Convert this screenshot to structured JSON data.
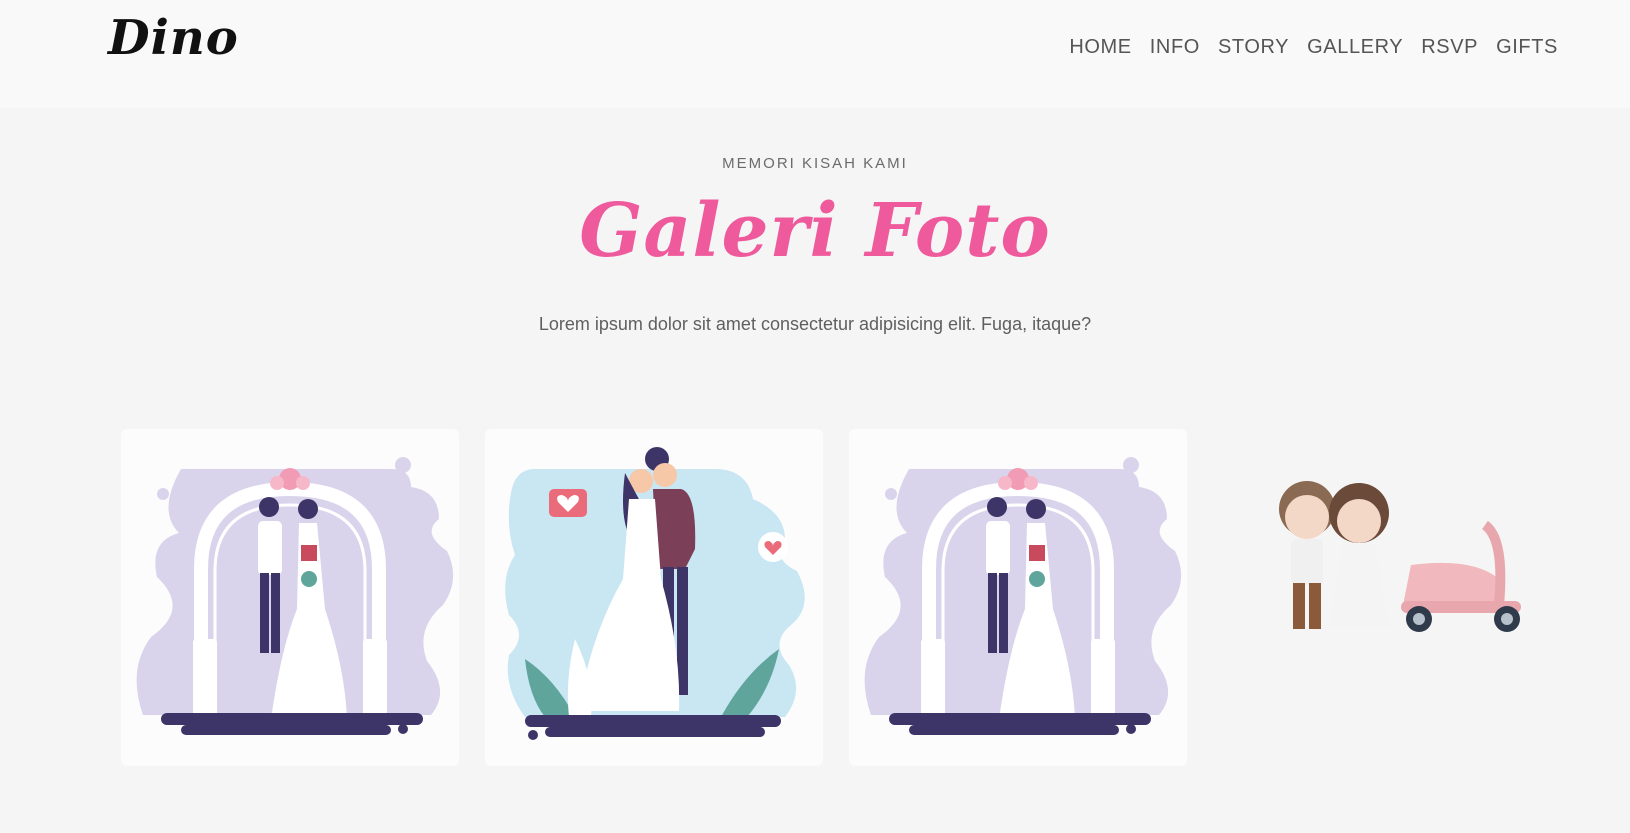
{
  "brand": "Dino",
  "nav": [
    "HOME",
    "INFO",
    "STORY",
    "GALLERY",
    "RSVP",
    "GIFTS"
  ],
  "section": {
    "subtitle": "MEMORI KISAH KAMI",
    "title": "Galeri Foto",
    "description": "Lorem ipsum dolor sit amet consectetur adipisicing elit. Fuga, itaque?"
  },
  "colors": {
    "accent": "#ee5a9c",
    "lavender": "#d9d4ec",
    "sky": "#c9e6f3",
    "navy": "#3d3468",
    "page_bg": "#f5f5f5"
  }
}
